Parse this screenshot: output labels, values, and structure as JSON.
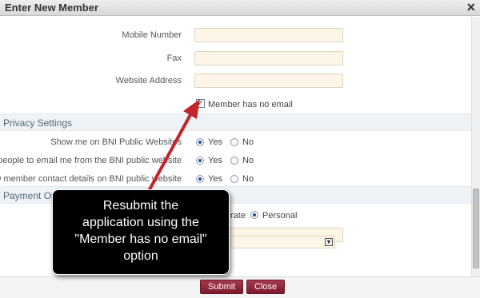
{
  "window": {
    "title": "Enter New Member",
    "close_icon": "×"
  },
  "contact": {
    "mobile_label": "Mobile Number",
    "fax_label": "Fax",
    "website_label": "Website Address",
    "no_email_label": "Member has no email",
    "no_email_checked": true
  },
  "privacy": {
    "section_title": "Privacy Settings",
    "rows": [
      {
        "label": "Show me on BNI Public Websites",
        "yes": "Yes",
        "no": "No",
        "value": "Yes"
      },
      {
        "label": "Allow people to email me from the BNI public website",
        "yes": "Yes",
        "no": "No",
        "value": "Yes"
      },
      {
        "label": "Show member contact details on BNI public website",
        "yes": "Yes",
        "no": "No",
        "value": "Yes"
      }
    ]
  },
  "payment": {
    "section_title": "Payment Op",
    "corporate_label": "rate",
    "personal_label": "Personal",
    "selected": "Personal"
  },
  "callout": {
    "lines": [
      "Resubmit the",
      "application using the",
      "\"Member has no email\"",
      "option"
    ]
  },
  "footer": {
    "submit_label": "Submit",
    "close_label": "Close"
  },
  "colors": {
    "accent_button": "#8b2236",
    "section_bg": "#eef3f8",
    "field_bg": "#fdf6e8",
    "arrow": "#c0262b"
  }
}
